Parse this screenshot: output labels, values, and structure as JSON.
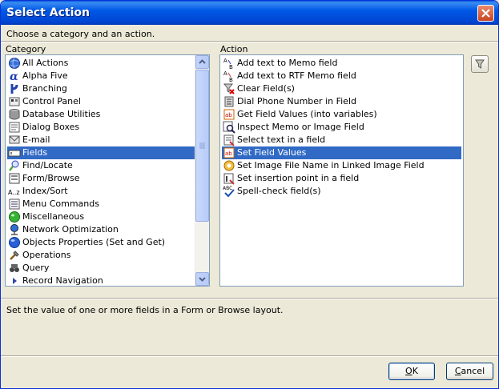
{
  "window": {
    "title": "Select Action"
  },
  "prompt": "Choose a category and an action.",
  "category": {
    "label": "Category",
    "items": [
      {
        "label": "All Actions",
        "icon": "globe-icon"
      },
      {
        "label": "Alpha Five",
        "icon": "alpha-icon"
      },
      {
        "label": "Branching",
        "icon": "branch-icon"
      },
      {
        "label": "Control Panel",
        "icon": "control-panel-icon"
      },
      {
        "label": "Database Utilities",
        "icon": "database-icon"
      },
      {
        "label": "Dialog Boxes",
        "icon": "dialog-icon"
      },
      {
        "label": "E-mail",
        "icon": "email-icon"
      },
      {
        "label": "Fields",
        "icon": "field-icon",
        "selected": true
      },
      {
        "label": "Find/Locate",
        "icon": "find-icon"
      },
      {
        "label": "Form/Browse",
        "icon": "form-icon"
      },
      {
        "label": "Index/Sort",
        "icon": "sort-icon"
      },
      {
        "label": "Menu Commands",
        "icon": "menu-icon"
      },
      {
        "label": "Miscellaneous",
        "icon": "misc-icon"
      },
      {
        "label": "Network Optimization",
        "icon": "network-icon"
      },
      {
        "label": "Objects Properties (Set and Get)",
        "icon": "objects-icon"
      },
      {
        "label": "Operations",
        "icon": "operations-icon"
      },
      {
        "label": "Query",
        "icon": "query-icon"
      },
      {
        "label": "Record Navigation",
        "icon": "navigation-icon"
      }
    ]
  },
  "action": {
    "label": "Action",
    "items": [
      {
        "label": "Add text to Memo field",
        "icon": "add-text-icon"
      },
      {
        "label": "Add text to RTF Memo field",
        "icon": "add-rtf-icon"
      },
      {
        "label": "Clear Field(s)",
        "icon": "clear-icon"
      },
      {
        "label": "Dial Phone Number in Field",
        "icon": "phone-icon"
      },
      {
        "label": "Get Field Values (into variables)",
        "icon": "get-values-icon"
      },
      {
        "label": "Inspect Memo or Image Field",
        "icon": "inspect-icon"
      },
      {
        "label": "Select text in a field",
        "icon": "select-text-icon"
      },
      {
        "label": "Set Field Values",
        "icon": "set-values-icon",
        "selected": true
      },
      {
        "label": "Set Image File Name in Linked Image Field",
        "icon": "image-icon"
      },
      {
        "label": "Set insertion point in a field",
        "icon": "insertion-icon"
      },
      {
        "label": "Spell-check field(s)",
        "icon": "spellcheck-icon"
      }
    ]
  },
  "filter_button": {
    "icon": "filter-icon"
  },
  "description": "Set the value of one or more fields in a Form or Browse layout.",
  "buttons": {
    "ok_first": "O",
    "ok_rest": "K",
    "cancel_first": "C",
    "cancel_rest": "ancel"
  },
  "colors": {
    "selection": "#316ac5",
    "titlebar": "#0058e6",
    "face": "#ece9d8"
  }
}
